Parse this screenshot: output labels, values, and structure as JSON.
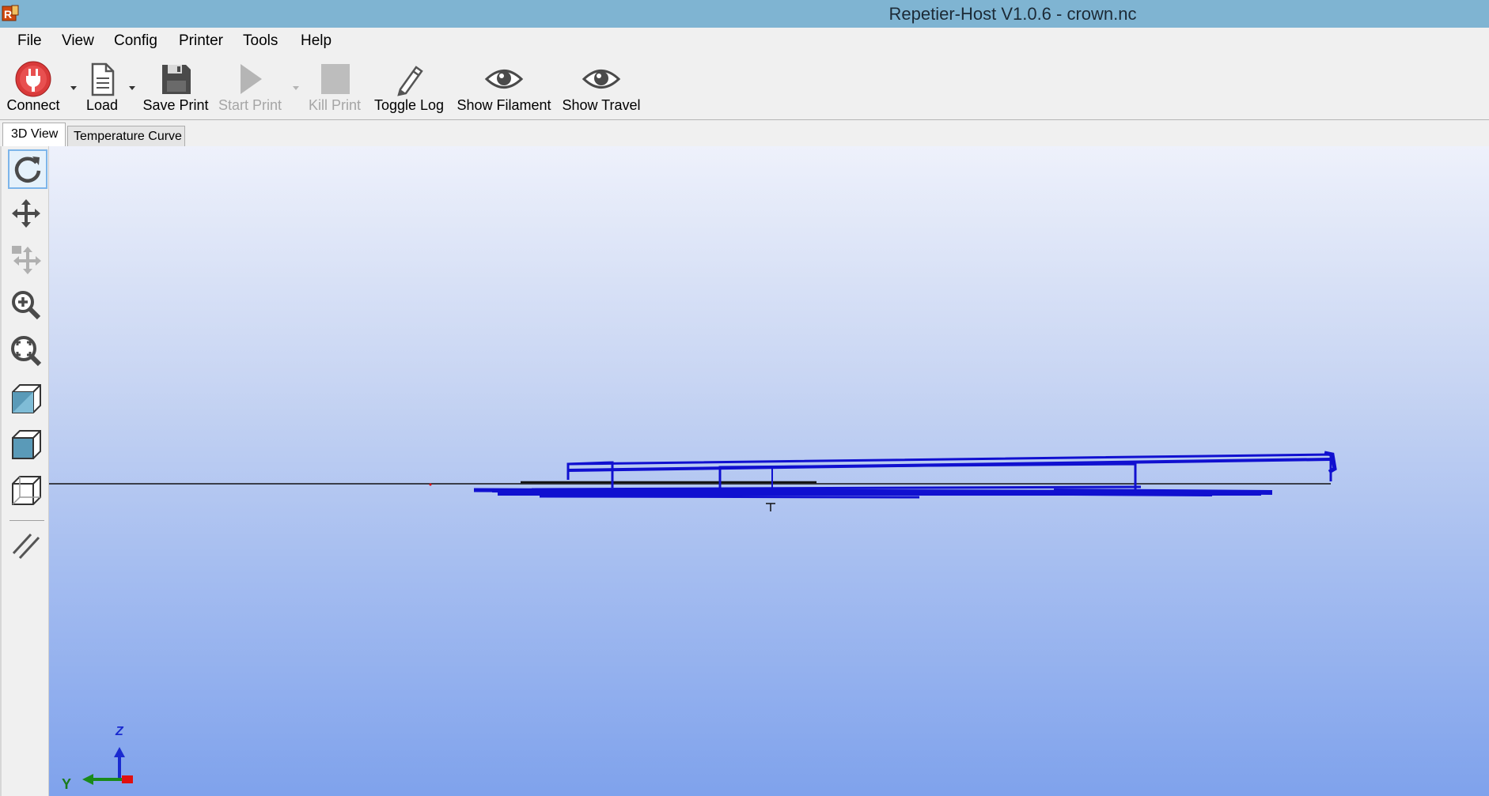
{
  "window": {
    "title": "Repetier-Host V1.0.6 - crown.nc"
  },
  "menu": {
    "items": [
      {
        "label": "File"
      },
      {
        "label": "View"
      },
      {
        "label": "Config"
      },
      {
        "label": "Printer"
      },
      {
        "label": "Tools"
      },
      {
        "label": "Help"
      }
    ]
  },
  "toolbar": {
    "connect_label": "Connect",
    "load_label": "Load",
    "save_label": "Save Print",
    "start_label": "Start Print",
    "kill_label": "Kill Print",
    "log_label": "Toggle Log",
    "filament_label": "Show Filament",
    "travel_label": "Show Travel"
  },
  "tabs": {
    "view3d": "3D View",
    "temperature": "Temperature Curve"
  },
  "viewport": {
    "axis_y": "Y",
    "axis_z": "Z",
    "colors": {
      "toolpath": "#1010d0",
      "axis_x": "#e01010",
      "axis_y": "#1a8a1a",
      "axis_z": "#1a2ad0"
    }
  },
  "sidebar": {
    "tools": [
      "rotate-icon",
      "move-icon",
      "move-object-icon",
      "zoom-icon",
      "fit-view-icon",
      "view-front-icon",
      "view-top-icon",
      "view-perspective-icon",
      "parallel-projection-icon"
    ]
  }
}
